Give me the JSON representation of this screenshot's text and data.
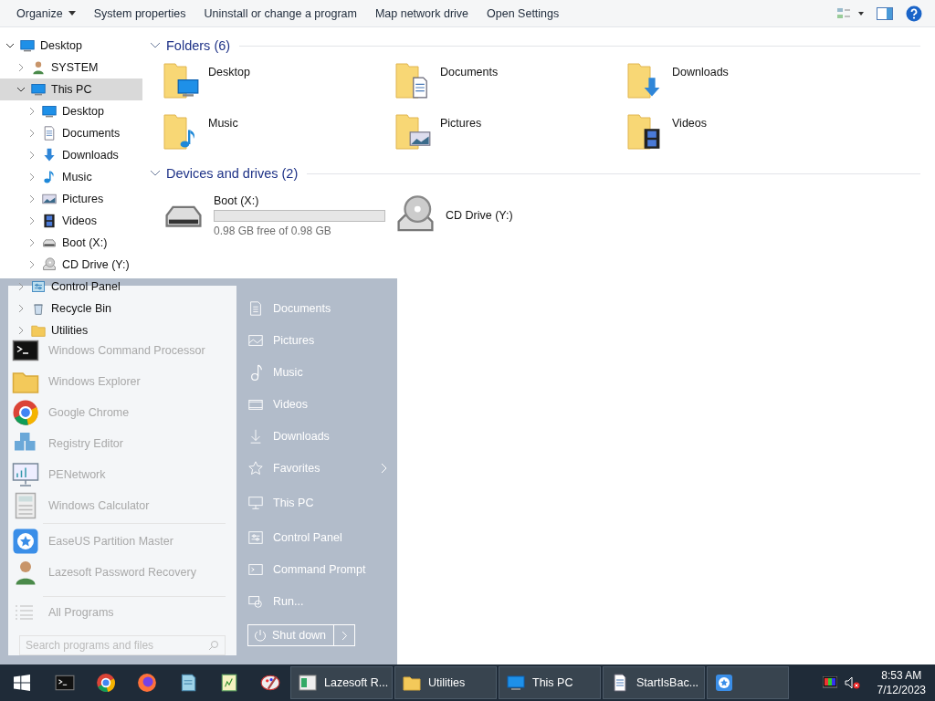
{
  "toolbar": {
    "items": [
      {
        "label": "Organize",
        "has_menu": true
      },
      {
        "label": "System properties",
        "has_menu": false
      },
      {
        "label": "Uninstall or change a program",
        "has_menu": false
      },
      {
        "label": "Map network drive",
        "has_menu": false
      },
      {
        "label": "Open Settings",
        "has_menu": false
      }
    ]
  },
  "nav_tree": {
    "items": [
      {
        "label": "Desktop",
        "kind": "desktop",
        "expanded": true,
        "selected": false,
        "children": [
          {
            "label": "SYSTEM",
            "kind": "user",
            "expanded": false,
            "selected": false
          },
          {
            "label": "This PC",
            "kind": "computer",
            "expanded": true,
            "selected": true,
            "children": [
              {
                "label": "Desktop",
                "kind": "desktop",
                "expanded": false,
                "selected": false
              },
              {
                "label": "Documents",
                "kind": "documents",
                "expanded": false,
                "selected": false
              },
              {
                "label": "Downloads",
                "kind": "downloads",
                "expanded": false,
                "selected": false
              },
              {
                "label": "Music",
                "kind": "music",
                "expanded": false,
                "selected": false
              },
              {
                "label": "Pictures",
                "kind": "pictures",
                "expanded": false,
                "selected": false
              },
              {
                "label": "Videos",
                "kind": "videos",
                "expanded": false,
                "selected": false
              },
              {
                "label": "Boot (X:)",
                "kind": "drive",
                "expanded": false,
                "selected": false
              },
              {
                "label": "CD Drive (Y:)",
                "kind": "cd-drive",
                "expanded": false,
                "selected": false
              }
            ]
          },
          {
            "label": "Control Panel",
            "kind": "control-panel",
            "expanded": false,
            "selected": false
          },
          {
            "label": "Recycle Bin",
            "kind": "recycle-bin",
            "expanded": false,
            "selected": false
          },
          {
            "label": "Utilities",
            "kind": "folder",
            "expanded": false,
            "selected": false
          }
        ]
      }
    ]
  },
  "sections": [
    {
      "title": "Folders (6)",
      "kind": "folders",
      "items": [
        {
          "label": "Desktop",
          "kind": "desktop"
        },
        {
          "label": "Documents",
          "kind": "documents"
        },
        {
          "label": "Downloads",
          "kind": "downloads"
        },
        {
          "label": "Music",
          "kind": "music"
        },
        {
          "label": "Pictures",
          "kind": "pictures"
        },
        {
          "label": "Videos",
          "kind": "videos"
        }
      ]
    },
    {
      "title": "Devices and drives (2)",
      "kind": "drives",
      "items": [
        {
          "label": "Boot (X:)",
          "kind": "drive",
          "level": 0,
          "free": "0.98 GB free of 0.98 GB"
        },
        {
          "label": "CD Drive (Y:)",
          "kind": "cd-drive"
        }
      ]
    }
  ],
  "start_menu": {
    "program_groups": [
      [
        {
          "label": "Windows Command Processor",
          "kind": "terminal"
        },
        {
          "label": "Windows Explorer",
          "kind": "folder"
        },
        {
          "label": "Google Chrome",
          "kind": "chrome"
        },
        {
          "label": "Registry Editor",
          "kind": "registry"
        },
        {
          "label": "PENetwork",
          "kind": "network"
        },
        {
          "label": "Windows Calculator",
          "kind": "calculator"
        }
      ],
      [
        {
          "label": "EaseUS Partition Master",
          "kind": "easeus"
        },
        {
          "label": "Lazesoft Password Recovery",
          "kind": "user"
        }
      ]
    ],
    "all_programs": "All Programs",
    "search": {
      "placeholder": "Search programs and files"
    },
    "places": [
      {
        "label": "Documents",
        "kind": "document",
        "has_submenu": false
      },
      {
        "label": "Pictures",
        "kind": "picture",
        "has_submenu": false
      },
      {
        "label": "Music",
        "kind": "note",
        "has_submenu": false
      },
      {
        "label": "Videos",
        "kind": "film",
        "has_submenu": false
      },
      {
        "label": "Downloads",
        "kind": "arrow-down",
        "has_submenu": false
      },
      {
        "label": "Favorites",
        "kind": "star",
        "has_submenu": true
      },
      {
        "label": "This PC",
        "kind": "monitor",
        "has_submenu": false
      },
      {
        "label": "Control Panel",
        "kind": "control-panel",
        "has_submenu": false
      },
      {
        "label": "Command Prompt",
        "kind": "terminal",
        "has_submenu": false
      },
      {
        "label": "Run...",
        "kind": "run",
        "has_submenu": false
      }
    ],
    "shutdown": "Shut down"
  },
  "taskbar": {
    "pinned": [
      {
        "kind": "terminal"
      },
      {
        "kind": "chrome"
      },
      {
        "kind": "firefox"
      },
      {
        "kind": "notepad"
      },
      {
        "kind": "notes"
      },
      {
        "kind": "paint"
      }
    ],
    "windows": [
      {
        "label": "Lazesoft R...",
        "kind": "app-window"
      },
      {
        "label": "Utilities",
        "kind": "folder"
      },
      {
        "label": "This PC",
        "kind": "computer"
      },
      {
        "label": "StartIsBac...",
        "kind": "document"
      },
      {
        "kind": "easeus"
      }
    ],
    "time": "8:53 AM",
    "date": "7/12/2023"
  }
}
